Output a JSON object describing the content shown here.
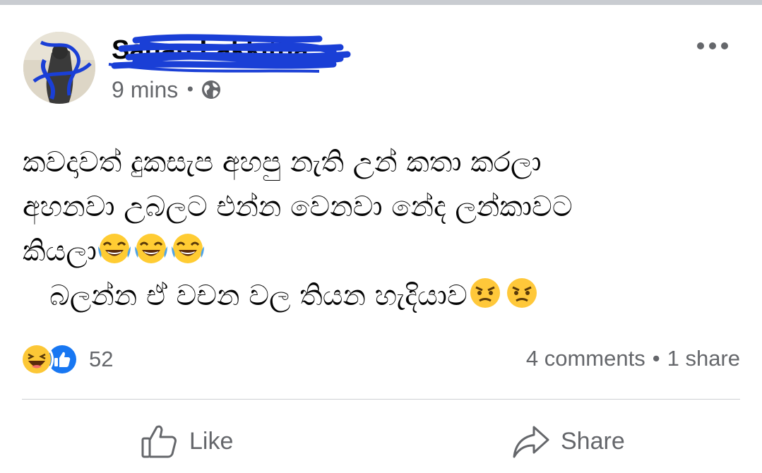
{
  "post": {
    "author": "Sahan Lakkitha",
    "time": "9 mins",
    "separator": "•",
    "privacy_icon": "globe-icon",
    "more_icon": "more-options-icon",
    "text_lines": [
      "කවදාවත් දුකසැප අහපු නැති උන් කතා කරලා",
      "අහනවා උබලට එන්න වෙනවා නේද ලන්කාවට",
      "කියලා",
      "   බලන්න ඒ වචන වල තියන හැදියාව"
    ],
    "line3_emojis": [
      "tears-of-joy-emoji",
      "tears-of-joy-emoji",
      "tears-of-joy-emoji"
    ],
    "line4_emojis": [
      "angry-emoji",
      "angry-emoji"
    ]
  },
  "reactions": {
    "icons": [
      "haha-reaction-icon",
      "like-reaction-icon"
    ],
    "count": "52"
  },
  "engagement": {
    "comments": "4 comments",
    "separator": "•",
    "shares": "1 share"
  },
  "actions": {
    "like_label": "Like",
    "share_label": "Share"
  },
  "colors": {
    "secondary_text": "#65676b",
    "primary_text": "#050505",
    "like_blue": "#1877f2",
    "scribble_blue": "#1a3fd6",
    "divider": "#ced0d4"
  }
}
